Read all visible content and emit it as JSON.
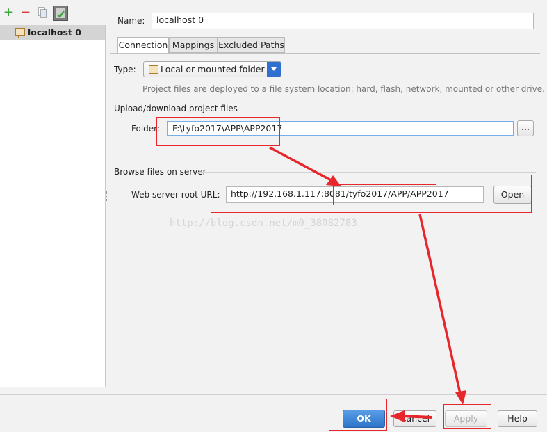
{
  "left_panel": {
    "toolbar_icons": [
      "add-icon",
      "remove-icon",
      "copy-icon",
      "default-server-icon"
    ],
    "server_item": "localhost 0"
  },
  "form": {
    "name_label": "Name:",
    "name_value": "localhost 0",
    "tabs": [
      "Connection",
      "Mappings",
      "Excluded Paths"
    ],
    "active_tab": "Connection",
    "type_label": "Type:",
    "type_value": "Local or mounted folder",
    "type_description": "Project files are deployed to a file system location: hard, flash, network, mounted or other drive.",
    "upload_section": "Upload/download project files",
    "folder_label": "Folder:",
    "folder_value": "F:\\tyfo2017\\APP\\APP2017",
    "browse_button": "...",
    "browse_section": "Browse files on server",
    "url_label": "Web server root URL:",
    "url_value": "http://192.168.1.117:8081/tyfo2017/APP/APP2017",
    "open_button": "Open"
  },
  "watermark": "http://blog.csdn.net/m0_38082783",
  "footer": {
    "ok": "OK",
    "cancel": "Cancel",
    "apply": "Apply",
    "help": "Help"
  },
  "colors": {
    "annotation_red": "#e8272c",
    "ok_blue": "#3d86d8",
    "selected_item": "#d4d4d4",
    "dropdown_arrow_blue": "#2f6fd0"
  }
}
